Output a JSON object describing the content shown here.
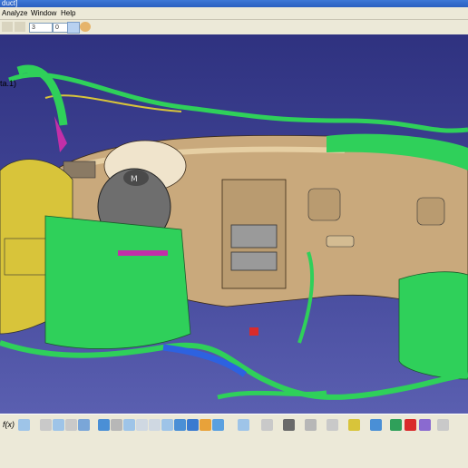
{
  "window": {
    "title": "duct]"
  },
  "menu": {
    "items": [
      "Analyze",
      "Window",
      "Help"
    ]
  },
  "toolbar": {
    "field_a": "3",
    "field_b": "0"
  },
  "tree": {
    "node_label": "ta.1)"
  },
  "bottom": {
    "formula_label": "f(x)"
  },
  "colors": {
    "background": "#3c3d8e",
    "dashboard": "#c9a97c",
    "harness": "#2fd05a",
    "door": "#d8c43a",
    "blue_harness": "#2d62e0",
    "magenta": "#c32fa8"
  }
}
